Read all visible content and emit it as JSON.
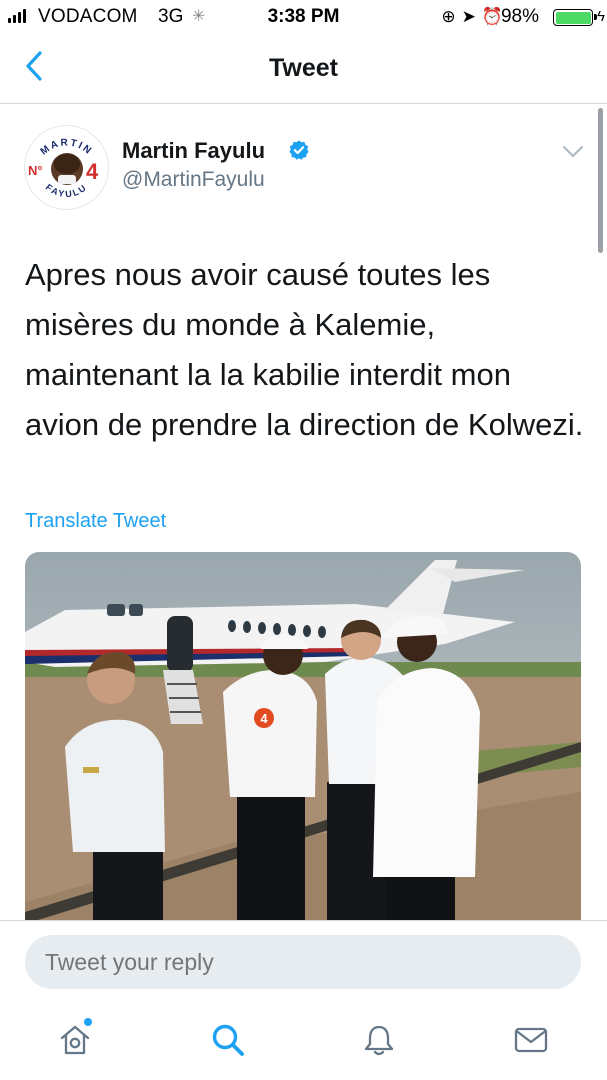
{
  "status_bar": {
    "carrier": "VODACOM",
    "network": "3G",
    "time": "3:38 PM",
    "battery_percent": "98%",
    "battery_level": 0.98
  },
  "nav": {
    "title": "Tweet",
    "back_icon": "chevron-left-icon"
  },
  "tweet": {
    "author_name": "Martin Fayulu",
    "author_handle": "@MartinFayulu",
    "avatar_badge": {
      "number_prefix": "N°",
      "number": "4",
      "ring_top": "MARTIN",
      "ring_bottom": "FAYULU"
    },
    "text": "Apres nous avoir causé toutes les misères du monde à Kalemie, maintenant la la kabilie interdit mon avion de prendre la direction de Kolwezi.",
    "translate_label": "Translate Tweet",
    "media_badge": "4"
  },
  "reply": {
    "placeholder": "Tweet your reply"
  },
  "tab_bar": {
    "items": [
      {
        "icon": "home-icon",
        "has_badge": true
      },
      {
        "icon": "search-icon",
        "active": true
      },
      {
        "icon": "bell-icon"
      },
      {
        "icon": "mail-icon"
      }
    ]
  },
  "colors": {
    "accent": "#1da1f2",
    "text_primary": "#14171a",
    "text_secondary": "#657786",
    "reply_bg": "#e6ecf0",
    "battery": "#4cd964"
  }
}
